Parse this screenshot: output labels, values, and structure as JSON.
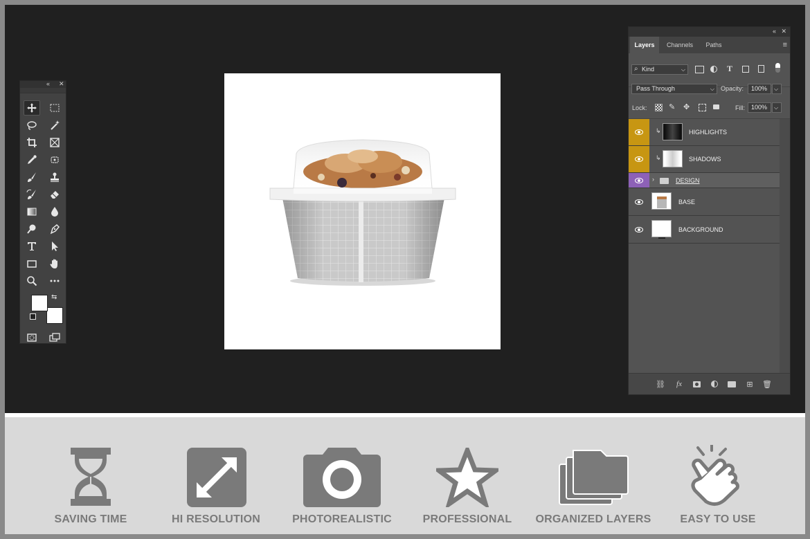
{
  "layers_panel": {
    "tabs": [
      {
        "label": "Layers",
        "active": true
      },
      {
        "label": "Channels",
        "active": false
      },
      {
        "label": "Paths",
        "active": false
      }
    ],
    "filter_kind": "Kind",
    "blend_mode": "Pass Through",
    "opacity_label": "Opacity:",
    "opacity_value": "100%",
    "lock_label": "Lock:",
    "fill_label": "Fill:",
    "fill_value": "100%",
    "layers": [
      {
        "name": "HIGHLIGHTS",
        "eye_color": "#c79612"
      },
      {
        "name": "SHADOWS",
        "eye_color": "#c79612"
      },
      {
        "name": "DESIGN",
        "eye_color": "#8d61b7"
      },
      {
        "name": "BASE",
        "eye_color": "#535353"
      },
      {
        "name": "BACKGROUND",
        "eye_color": "#535353"
      }
    ]
  },
  "features": [
    {
      "label": "SAVING TIME",
      "icon": "hourglass-icon"
    },
    {
      "label": "HI RESOLUTION",
      "icon": "expand-icon"
    },
    {
      "label": "PHOTOREALISTIC",
      "icon": "camera-icon"
    },
    {
      "label": "PROFESSIONAL",
      "icon": "star-icon"
    },
    {
      "label": "ORGANIZED LAYERS",
      "icon": "folders-icon"
    },
    {
      "label": "EASY TO USE",
      "icon": "hand-pointer-icon"
    }
  ],
  "colors": {
    "workspace": "#202020",
    "panel": "#535353",
    "highlight_eye": "#c79612",
    "group_eye": "#8d61b7",
    "feature_icon": "#7a7a7a"
  }
}
